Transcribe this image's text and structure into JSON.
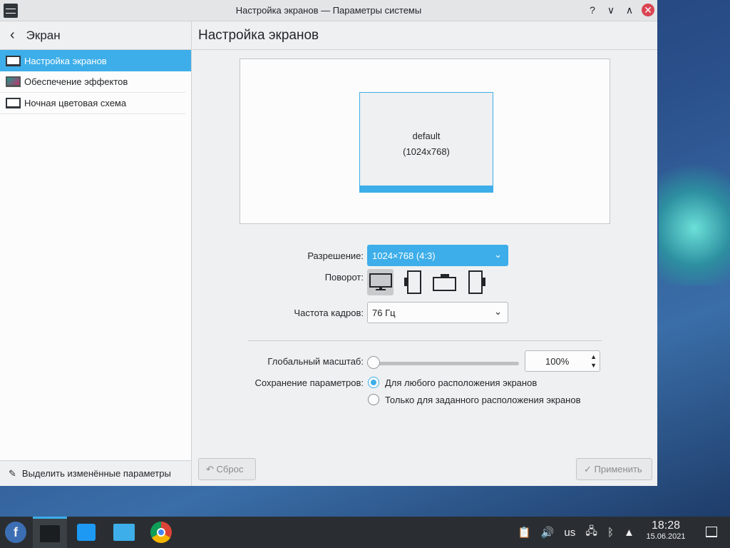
{
  "window": {
    "title": "Настройка экранов — Параметры системы",
    "help": "?",
    "minimize": "∨",
    "maximize": "∧",
    "close": "✕"
  },
  "sidebar": {
    "back_label": "Экран",
    "items": [
      {
        "label": "Настройка экранов"
      },
      {
        "label": "Обеспечение эффектов"
      },
      {
        "label": "Ночная цветовая схема"
      }
    ],
    "footer_label": "Выделить изменённые параметры"
  },
  "main": {
    "title": "Настройка экранов",
    "preview": {
      "name": "default",
      "resolution": "(1024x768)"
    },
    "resolution_label": "Разрешение:",
    "resolution_value": "1024×768 (4:3)",
    "rotation_label": "Поворот:",
    "refresh_label": "Частота кадров:",
    "refresh_value": "76 Гц",
    "scale_label": "Глобальный масштаб:",
    "scale_value": "100%",
    "scale_fraction": 0,
    "save_label": "Сохранение параметров:",
    "save_options": [
      {
        "label": "Для любого расположения экранов",
        "checked": true
      },
      {
        "label": "Только для заданного расположения экранов",
        "checked": false
      }
    ],
    "reset_button": "Сброс",
    "apply_button": "Применить"
  },
  "taskbar": {
    "keyboard_layout": "us",
    "time": "18:28",
    "date": "15.06.2021"
  },
  "colors": {
    "accent": "#3daee9",
    "close": "#da4453",
    "taskbar": "#2a2e32"
  }
}
